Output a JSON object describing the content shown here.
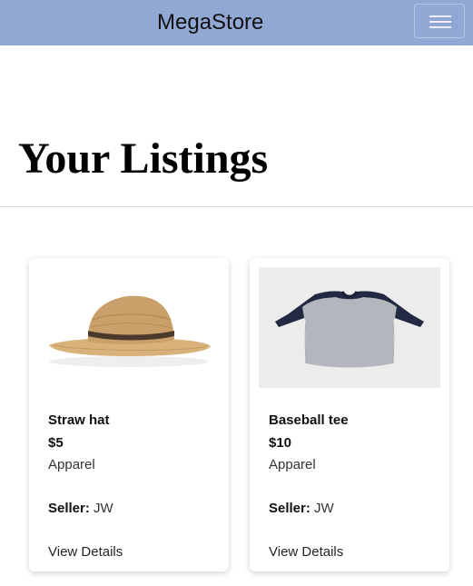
{
  "navbar": {
    "brand": "MegaStore",
    "toggle_icon": "hamburger-menu-icon",
    "background": "#91a8d4"
  },
  "page": {
    "title": "Your Listings"
  },
  "listings": [
    {
      "name": "Straw hat",
      "price": "$5",
      "category": "Apparel",
      "seller_label": "Seller:",
      "seller": "JW",
      "link": "View Details",
      "image": "straw-hat-image"
    },
    {
      "name": "Baseball tee",
      "price": "$10",
      "category": "Apparel",
      "seller_label": "Seller:",
      "seller": "JW",
      "link": "View Details",
      "image": "baseball-tee-image"
    }
  ]
}
